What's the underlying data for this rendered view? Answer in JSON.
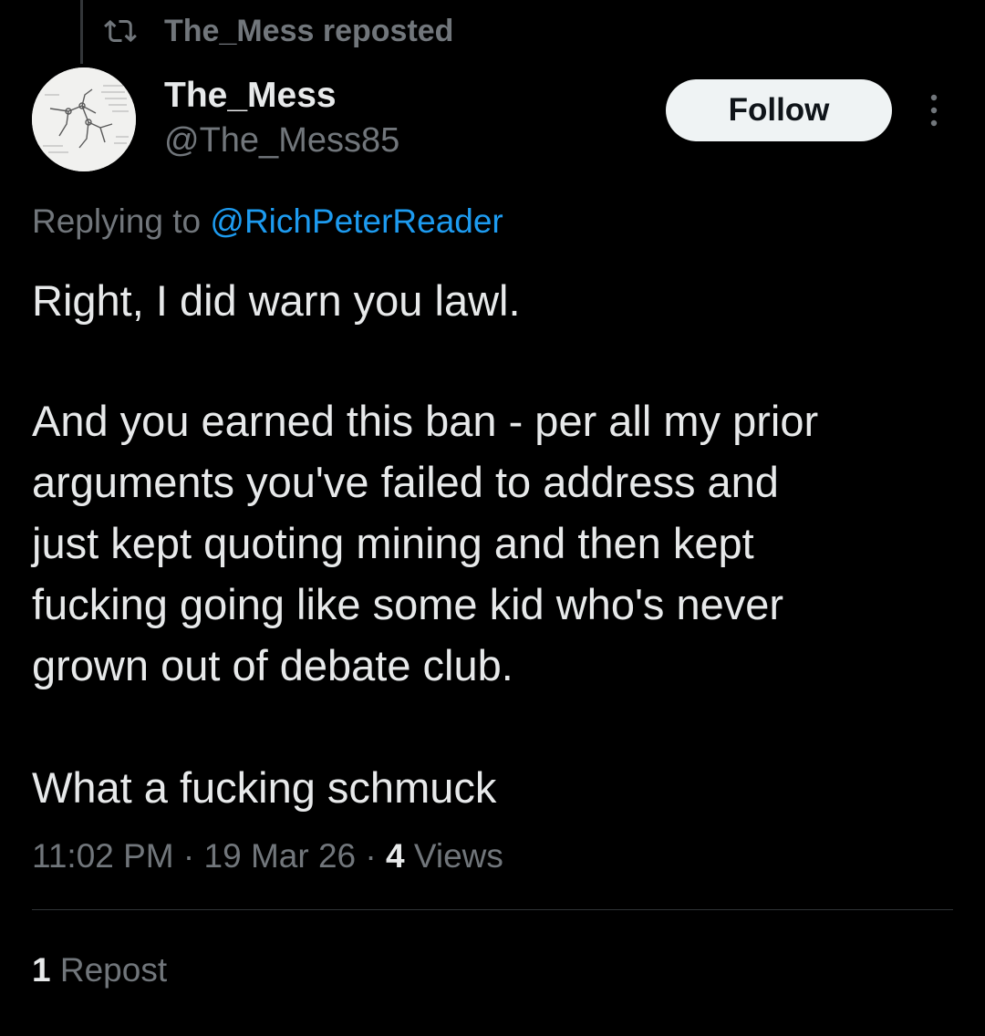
{
  "repost_header": {
    "icon": "repost-icon",
    "text": "The_Mess reposted"
  },
  "author": {
    "avatar_icon": "avatar-sketch",
    "display_name": "The_Mess",
    "handle": "@The_Mess85"
  },
  "actions": {
    "follow_label": "Follow",
    "more_icon": "more-vertical-icon"
  },
  "reply": {
    "prefix": "Replying to",
    "mention": "@RichPeterReader"
  },
  "tweet": {
    "lines": [
      "Right, I did warn you lawl.",
      "And you earned this ban - per all my prior",
      "arguments you've failed to address and",
      "just kept quoting mining and then kept",
      "fucking going like some kid who's never",
      "grown out of debate club.",
      "What a fucking schmuck"
    ]
  },
  "meta": {
    "time": "11:02 PM",
    "separator": "·",
    "date": "19 Mar 26",
    "views_count": "4",
    "views_label": "Views"
  },
  "stats": {
    "repost_count": "1",
    "repost_label": "Repost"
  },
  "colors": {
    "background": "#000000",
    "text_primary": "#e7e9ea",
    "text_secondary": "#71767b",
    "link": "#1d9bf0",
    "follow_bg": "#eff3f4",
    "divider": "#2f3336"
  }
}
